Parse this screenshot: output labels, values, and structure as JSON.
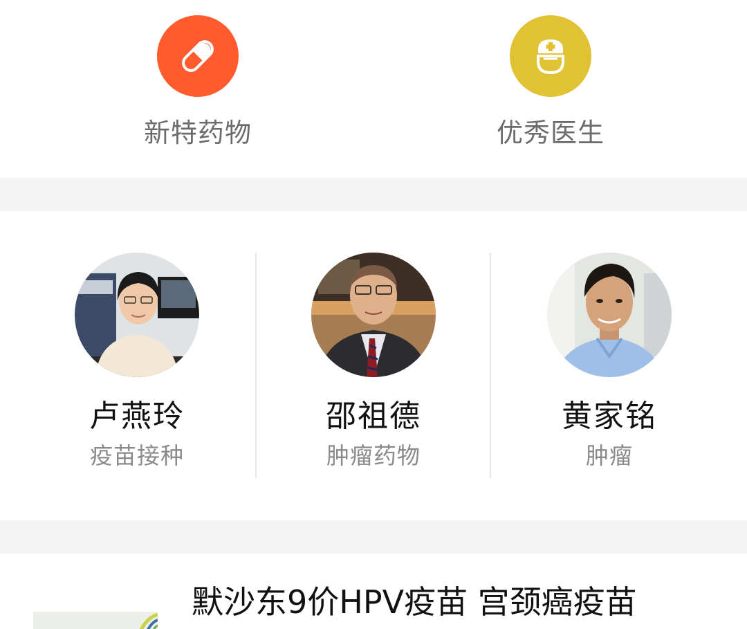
{
  "categories": [
    {
      "label": "新特药物",
      "icon": "pill-icon",
      "color": "#FF5B2E"
    },
    {
      "label": "优秀医生",
      "icon": "doctor-icon",
      "color": "#E2C235"
    }
  ],
  "doctors": [
    {
      "name": "卢燕玲",
      "specialty": "疫苗接种"
    },
    {
      "name": "邵祖德",
      "specialty": "肿瘤药物"
    },
    {
      "name": "黄家铭",
      "specialty": "肿瘤"
    }
  ],
  "article": {
    "title": "默沙东9价HPV疫苗 宫颈癌疫苗"
  },
  "colors": {
    "section_gap": "#F4F4F4",
    "label_gray": "#6B6B6B",
    "name_black": "#111111"
  }
}
